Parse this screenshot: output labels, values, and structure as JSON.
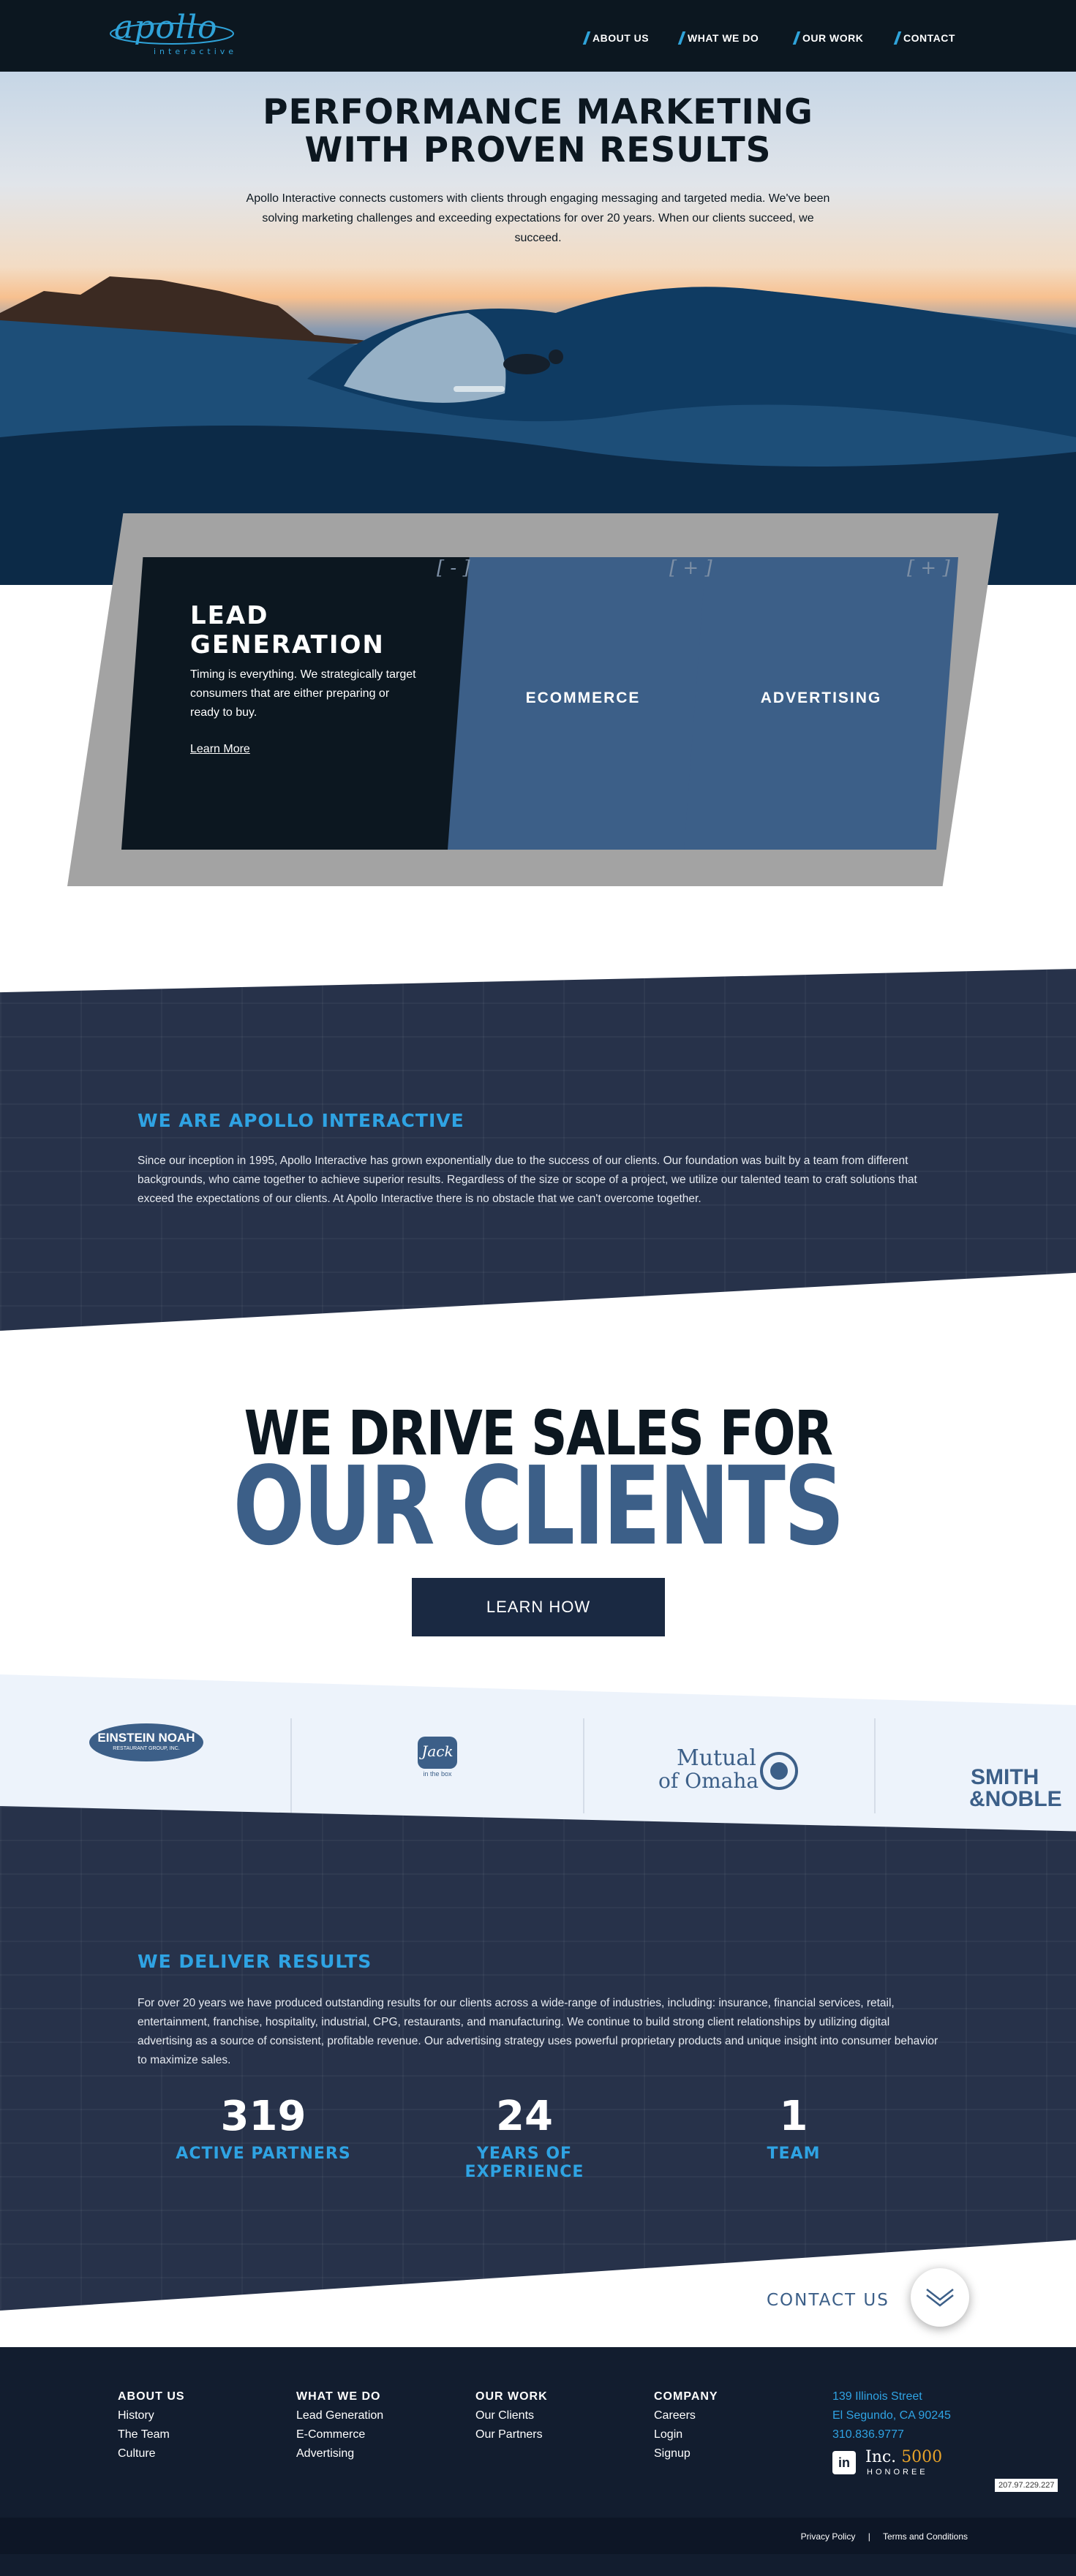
{
  "header": {
    "logo_word": "apollo",
    "logo_sub": "interactive",
    "nav": [
      "ABOUT US",
      "WHAT WE DO",
      "OUR WORK",
      "CONTACT"
    ]
  },
  "hero": {
    "title_line1": "PERFORMANCE MARKETING",
    "title_line2": "WITH PROVEN RESULTS",
    "text": "Apollo Interactive connects customers with clients through engaging messaging and targeted media. We've been solving marketing challenges and exceeding expectations for over 20 years. When our clients succeed, we succeed."
  },
  "cards": {
    "lead": {
      "toggle": "[ - ]",
      "title_line1": "LEAD",
      "title_line2": "GENERATION",
      "text": "Timing is everything. We strategically target consumers that are either preparing or ready to buy.",
      "link": "Learn More"
    },
    "ecommerce": {
      "toggle": "[ + ]",
      "title": "ECOMMERCE"
    },
    "advertising": {
      "toggle": "[ + ]",
      "title": "ADVERTISING"
    }
  },
  "about": {
    "heading": "WE ARE APOLLO INTERACTIVE",
    "text": "Since our inception in 1995, Apollo Interactive has grown exponentially due to the success of our clients. Our foundation was built by a team from different backgrounds, who came together to achieve superior results. Regardless of the size or scope of a project, we utilize our talented team to craft solutions that exceed the expectations of our clients. At Apollo Interactive there is no obstacle that we can't overcome together."
  },
  "drive": {
    "line1": "WE DRIVE SALES FOR",
    "line2": "OUR CLIENTS",
    "button": "LEARN HOW"
  },
  "client_logos": {
    "einstein": "EINSTEIN NOAH",
    "einstein_sub": "RESTAURANT GROUP, INC.",
    "jack": "Jack",
    "jack_sub": "in the box",
    "mutual_top": "Mutual",
    "mutual_bottom": "of Omaha",
    "smith1": "SMITH",
    "smith2": "&NOBLE"
  },
  "results": {
    "heading": "WE DELIVER RESULTS",
    "text": "For over 20 years we have produced outstanding results for our clients across a wide-range of industries, including: insurance, financial services, retail, entertainment, franchise, hospitality, industrial, CPG, restaurants, and manufacturing. We continue to build strong client relationships by utilizing digital advertising as a source of consistent, profitable revenue. Our advertising strategy uses powerful proprietary products and unique insight into consumer behavior to maximize sales.",
    "stats": [
      {
        "value": "319",
        "label": "ACTIVE PARTNERS"
      },
      {
        "value": "24",
        "label": "YEARS OF EXPERIENCE"
      },
      {
        "value": "1",
        "label": "TEAM"
      }
    ]
  },
  "contact": {
    "label": "CONTACT US"
  },
  "footer": {
    "columns": [
      {
        "heading": "ABOUT US",
        "links": [
          "History",
          "The Team",
          "Culture"
        ]
      },
      {
        "heading": "WHAT WE DO",
        "links": [
          "Lead Generation",
          "E-Commerce",
          "Advertising"
        ]
      },
      {
        "heading": "OUR WORK",
        "links": [
          "Our Clients",
          "Our Partners"
        ]
      },
      {
        "heading": "COMPANY",
        "links": [
          "Careers",
          "Login",
          "Signup"
        ]
      }
    ],
    "address": [
      "139 Illinois Street",
      "El Segundo, CA 90245",
      "310.836.9777"
    ],
    "inc_brand": "Inc.",
    "inc_number": "5000",
    "inc_sub": "HONOREE",
    "ip": "207.97.229.227",
    "bottom_links": [
      "Privacy Policy",
      "Terms and Conditions"
    ]
  },
  "colors": {
    "dark": "#0c1720",
    "accent": "#2fa3e3",
    "card_blue": "#3c5f88",
    "band": "#27324a"
  }
}
